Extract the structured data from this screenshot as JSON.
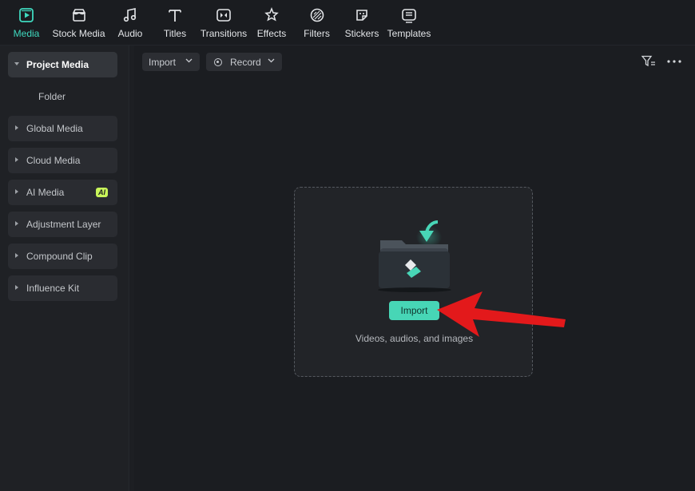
{
  "toolbar": {
    "items": [
      {
        "label": "Media",
        "icon": "media-icon",
        "active": true
      },
      {
        "label": "Stock Media",
        "icon": "stock-media-icon"
      },
      {
        "label": "Audio",
        "icon": "audio-icon"
      },
      {
        "label": "Titles",
        "icon": "titles-icon"
      },
      {
        "label": "Transitions",
        "icon": "transitions-icon"
      },
      {
        "label": "Effects",
        "icon": "effects-icon"
      },
      {
        "label": "Filters",
        "icon": "filters-icon"
      },
      {
        "label": "Stickers",
        "icon": "stickers-icon"
      },
      {
        "label": "Templates",
        "icon": "templates-icon"
      }
    ],
    "accent_color": "#3fd9bf"
  },
  "sidebar": {
    "items": [
      {
        "label": "Project Media",
        "expanded": true,
        "active": true
      },
      {
        "label": "Folder",
        "sub": true
      },
      {
        "label": "Global Media"
      },
      {
        "label": "Cloud Media"
      },
      {
        "label": "AI Media",
        "badge": "AI"
      },
      {
        "label": "Adjustment Layer"
      },
      {
        "label": "Compound Clip"
      },
      {
        "label": "Influence Kit"
      }
    ]
  },
  "main": {
    "import_dropdown_label": "Import",
    "record_dropdown_label": "Record",
    "filter_icon": "filter-icon",
    "more_icon": "more-icon",
    "dropzone": {
      "button_label": "Import",
      "caption": "Videos, audios, and images",
      "button_color": "#47d6b6"
    },
    "annotation_arrow_color": "#e3191b"
  }
}
